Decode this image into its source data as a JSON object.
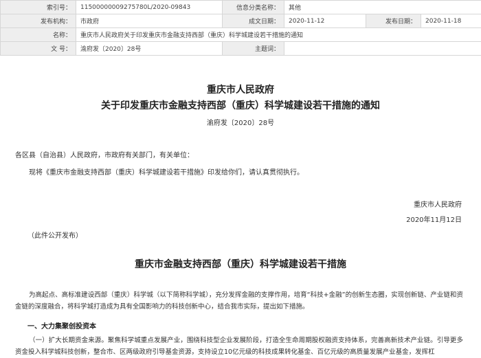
{
  "meta_table": {
    "index_label": "索引号：",
    "index_value": "11500000009275780L/2020-09843",
    "category_label": "信息分类名称：",
    "category_value": "其他",
    "issuer_label": "发布机构：",
    "issuer_value": "市政府",
    "created_label": "成文日期：",
    "created_value": "2020-11-12",
    "published_label": "发布日期：",
    "published_value": "2020-11-18",
    "name_label": "名称：",
    "name_value": "重庆市人民政府关于印发重庆市金融支持西部（重庆）科学城建设若干措施的通知",
    "docno_label": "文 号：",
    "docno_value": "渝府发〔2020〕28号",
    "subject_label": "主题词：",
    "subject_value": ""
  },
  "document": {
    "title_line1": "重庆市人民政府",
    "title_line2": "关于印发重庆市金融支持西部（重庆）科学城建设若干措施的通知",
    "doc_number": "渝府发〔2020〕28号",
    "salutation": "各区县（自治县）人民政府，市政府有关部门，有关单位：",
    "body_line": "现将《重庆市金融支持西部（重庆）科学城建设若干措施》印发给你们，请认真贯彻执行。",
    "signer": "重庆市人民政府",
    "date": "2020年11月12日",
    "public_note": "（此件公开发布）",
    "measures_title": "重庆市金融支持西部（重庆）科学城建设若干措施",
    "intro_paragraph": "为高起点、高标准建设西部（重庆）科学城（以下简称科学城），充分发挥金融的支撑作用，培育“科技+金融”的创新生态圈，实现创新链、产业链和资金链的深度融合，将科学城打造成为具有全国影响力的科技创新中心，结合我市实际，提出如下措施。",
    "section1": "一、大力集聚创投资本",
    "item1_paragraph": "（一）扩大长期资金来源。聚焦科学城重点发展产业，围绕科技型企业发展阶段，打造全生命周期股权融资支持体系，完善高新技术产业链。引导更多资金投入科学城科技创新，整合市、区两级政府引导基金资源，支持设立10亿元级的科技成果转化基金、百亿元级的高质量发展产业基金，发挥杠"
  }
}
